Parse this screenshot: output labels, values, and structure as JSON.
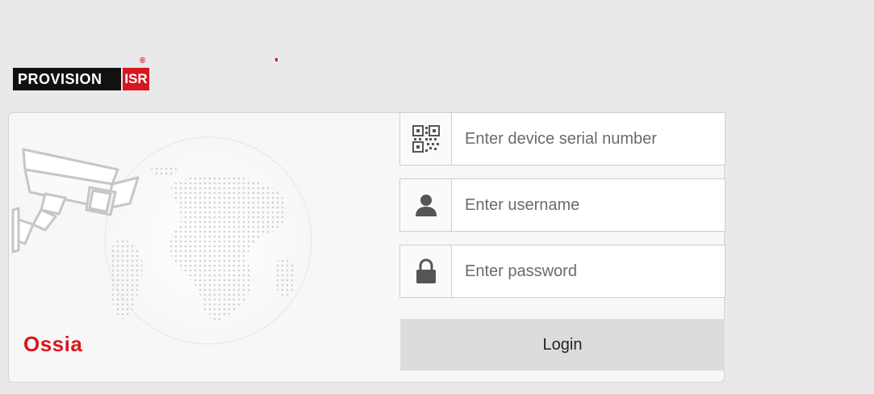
{
  "logo": {
    "left_text": "PROVISION",
    "right_text": "ISR",
    "registered": "®"
  },
  "brand": {
    "product_name": "Ossia"
  },
  "form": {
    "serial": {
      "placeholder": "Enter device serial number",
      "value": ""
    },
    "username": {
      "placeholder": "Enter username",
      "value": ""
    },
    "password": {
      "placeholder": "Enter password",
      "value": ""
    },
    "login_label": "Login"
  },
  "icons": {
    "serial": "qr-code-icon",
    "username": "user-icon",
    "password": "lock-icon"
  },
  "colors": {
    "background": "#e9e9e9",
    "brand_red": "#d7171f",
    "panel": "#f7f7f7",
    "button": "#dcdcdc"
  }
}
